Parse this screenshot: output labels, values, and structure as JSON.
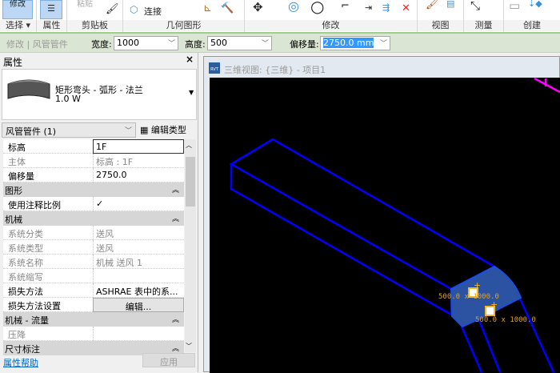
{
  "ribbon": {
    "groups": [
      {
        "label": "选择 ▾",
        "button": "修改"
      },
      {
        "label": "属性"
      },
      {
        "label": "剪贴板",
        "button": "粘贴"
      },
      {
        "label": "几何图形",
        "button": "连接"
      },
      {
        "label": "修改"
      },
      {
        "label": "视图"
      },
      {
        "label": "测量"
      },
      {
        "label": "创建"
      }
    ]
  },
  "options_bar": {
    "context": "修改 | 风管管件",
    "width_label": "宽度:",
    "width_value": "1000",
    "height_label": "高度:",
    "height_value": "500",
    "offset_label": "偏移量:",
    "offset_value": "2750.0 mm"
  },
  "properties": {
    "title": "属性",
    "type_name": "矩形弯头 - 弧形 - 法兰",
    "type_sub": "1.0 W",
    "filter": "风管管件 (1)",
    "edit_type": "编辑类型",
    "rows": [
      {
        "k": "标高",
        "v": "1F"
      },
      {
        "k": "主体",
        "v": "标高 : 1F"
      },
      {
        "k": "偏移量",
        "v": "2750.0"
      },
      {
        "section": "图形"
      },
      {
        "k": "使用注释比例",
        "v": "✓"
      },
      {
        "section": "机械"
      },
      {
        "k": "系统分类",
        "v": "送风"
      },
      {
        "k": "系统类型",
        "v": "送风"
      },
      {
        "k": "系统名称",
        "v": "机械 送风 1"
      },
      {
        "k": "系统缩写",
        "v": ""
      },
      {
        "k": "损失方法",
        "v": "ASHRAE 表中的系..."
      },
      {
        "k": "损失方法设置",
        "v": "编辑..."
      },
      {
        "section": "机械 - 流量"
      },
      {
        "k": "压降",
        "v": ""
      },
      {
        "section": "尺寸标注"
      }
    ],
    "help_link": "属性帮助",
    "apply": "应用"
  },
  "view": {
    "title": "三维视图: {三维} - 项目1",
    "dim1": "500.0 x 1000.0",
    "dim2": "500.0 x 1000.0",
    "colors": {
      "duct": "#0000ff",
      "selected": "#3a6fd8",
      "grip": "#f5b820",
      "magenta": "#ff00ff"
    }
  }
}
